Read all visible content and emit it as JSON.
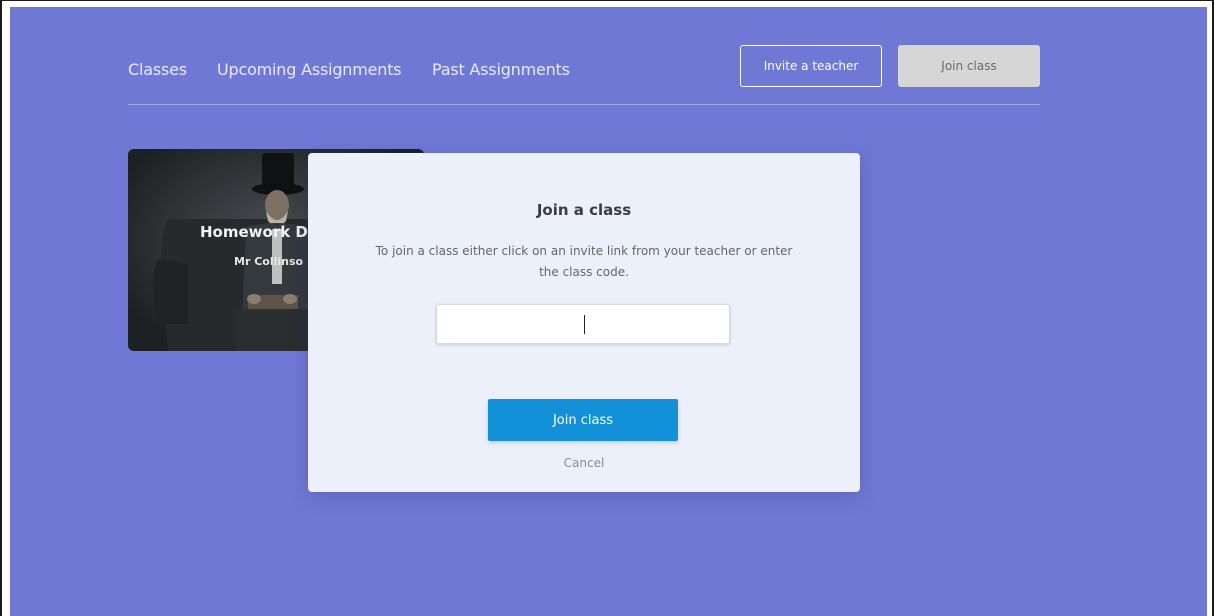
{
  "nav": {
    "classes": "Classes",
    "upcoming": "Upcoming Assignments",
    "past": "Past Assignments",
    "invite_teacher": "Invite a teacher",
    "join_class": "Join class"
  },
  "class_card": {
    "title": "Homework D",
    "teacher": "Mr Collinso"
  },
  "modal": {
    "title": "Join a class",
    "description": "To join a class either click on an invite link from your teacher or enter the class code.",
    "code_value": "",
    "join_button": "Join class",
    "cancel": "Cancel"
  },
  "colors": {
    "background": "#6f78d5",
    "modal": "#ecf0fb",
    "primary_button": "#1291d8",
    "secondary_button": "#d6d6d6"
  }
}
